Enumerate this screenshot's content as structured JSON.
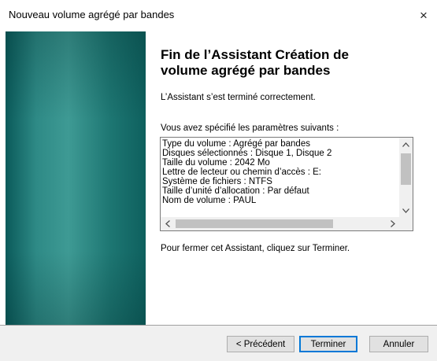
{
  "window": {
    "title": "Nouveau volume agrégé par bandes",
    "close_label": "×"
  },
  "main": {
    "heading_line1": "Fin de l’Assistant Création de",
    "heading_line2": "volume agrégé par bandes",
    "success_text": "L’Assistant s’est terminé correctement.",
    "params_label": "Vous avez spécifié les paramètres suivants :",
    "params": [
      "Type du volume : Agrégé par bandes",
      "Disques sélectionnés : Disque 1, Disque 2",
      "Taille du volume : 2042 Mo",
      "Lettre de lecteur ou chemin d’accès : E:",
      "Système de fichiers : NTFS",
      "Taille d’unité d’allocation : Par défaut",
      "Nom de volume : PAUL"
    ],
    "finish_instruction": "Pour fermer cet Assistant, cliquez sur Terminer."
  },
  "scroll_icons": {
    "up": "arrow-up-icon",
    "down": "arrow-down-icon",
    "left": "arrow-left-icon",
    "right": "arrow-right-icon"
  },
  "footer": {
    "prev_label": "< Précédent",
    "finish_label": "Terminer",
    "cancel_label": "Annuler"
  },
  "colors": {
    "banner": "#2e8a86",
    "default_button_border": "#0078d7",
    "footer_bg": "#f0f0f0"
  }
}
